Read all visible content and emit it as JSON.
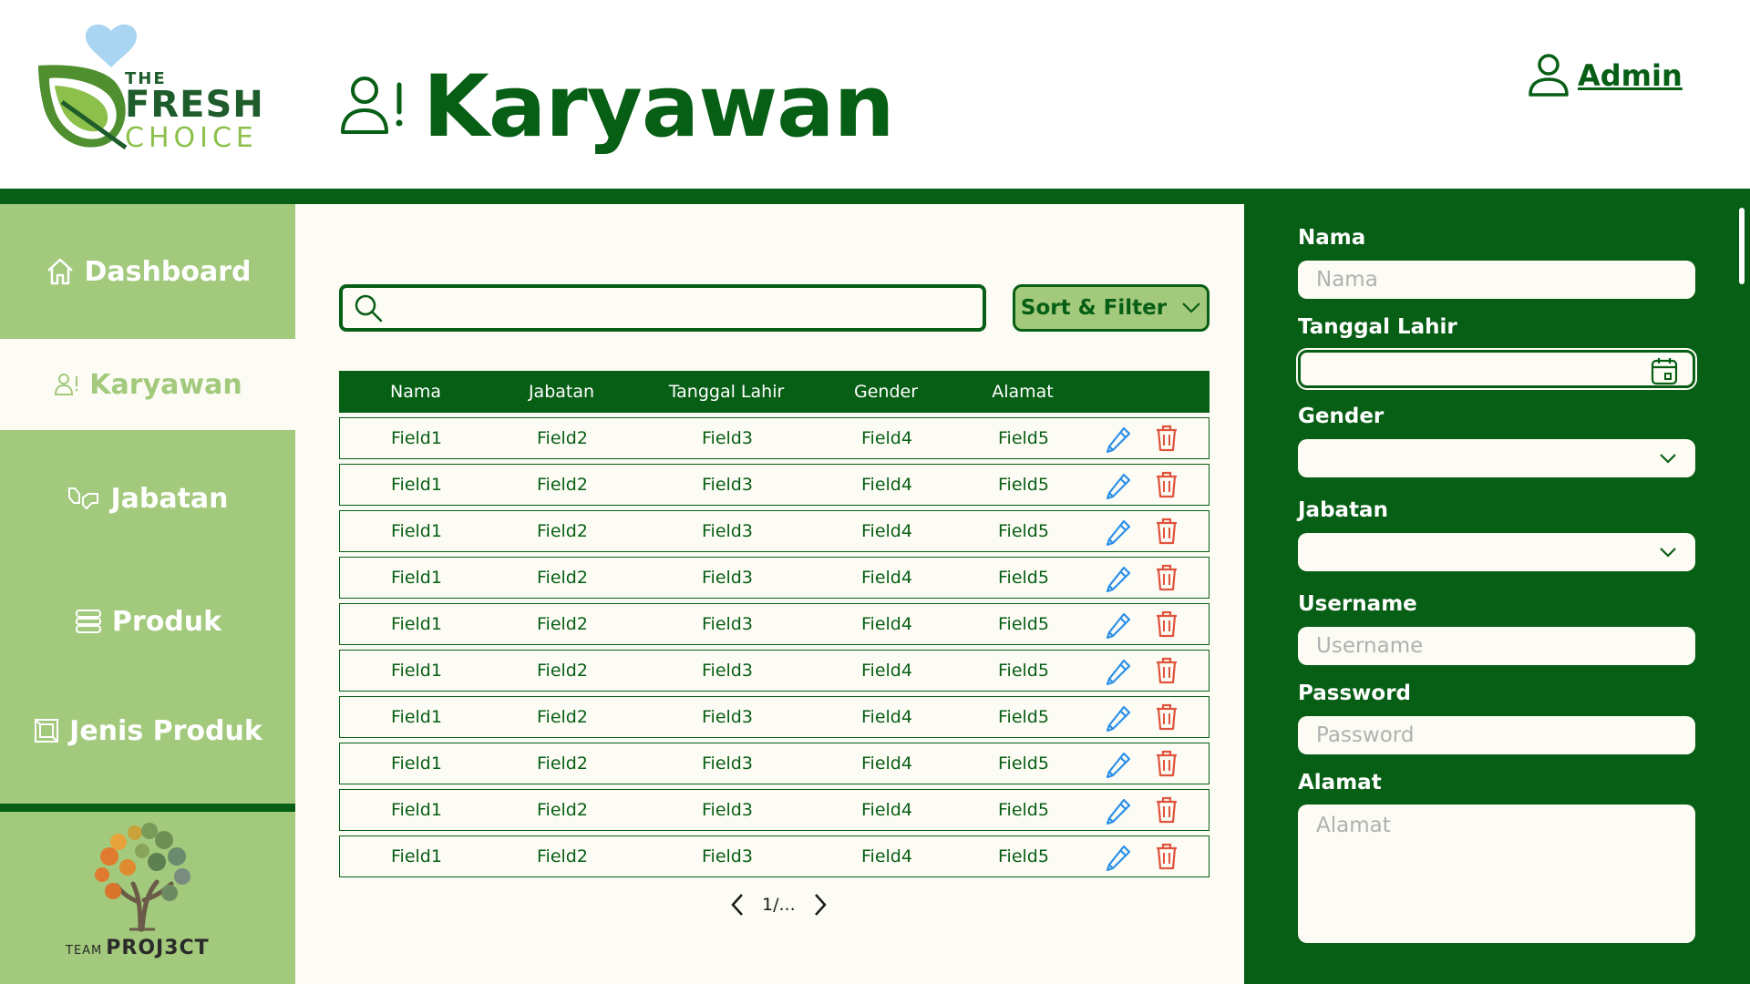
{
  "brand": {
    "logo_the": "THE",
    "logo_fresh": "FRESH",
    "logo_choice": "CHOICE",
    "team_small": "TEAM",
    "team_big": "PROJ3CT"
  },
  "header": {
    "title": "Karyawan",
    "user_label": "Admin"
  },
  "sidebar": {
    "items": [
      {
        "label": "Dashboard",
        "icon": "home-icon",
        "active": false
      },
      {
        "label": "Karyawan",
        "icon": "employee-icon",
        "active": true
      },
      {
        "label": "Jabatan",
        "icon": "handshake-icon",
        "active": false
      },
      {
        "label": "Produk",
        "icon": "stack-icon",
        "active": false
      },
      {
        "label": "Jenis Produk",
        "icon": "frame-icon",
        "active": false
      }
    ]
  },
  "toolbar": {
    "search_placeholder": "",
    "sort_filter_label": "Sort & Filter"
  },
  "table": {
    "columns": [
      "Nama",
      "Jabatan",
      "Tanggal Lahir",
      "Gender",
      "Alamat"
    ],
    "rows": [
      [
        "Field1",
        "Field2",
        "Field3",
        "Field4",
        "Field5"
      ],
      [
        "Field1",
        "Field2",
        "Field3",
        "Field4",
        "Field5"
      ],
      [
        "Field1",
        "Field2",
        "Field3",
        "Field4",
        "Field5"
      ],
      [
        "Field1",
        "Field2",
        "Field3",
        "Field4",
        "Field5"
      ],
      [
        "Field1",
        "Field2",
        "Field3",
        "Field4",
        "Field5"
      ],
      [
        "Field1",
        "Field2",
        "Field3",
        "Field4",
        "Field5"
      ],
      [
        "Field1",
        "Field2",
        "Field3",
        "Field4",
        "Field5"
      ],
      [
        "Field1",
        "Field2",
        "Field3",
        "Field4",
        "Field5"
      ],
      [
        "Field1",
        "Field2",
        "Field3",
        "Field4",
        "Field5"
      ],
      [
        "Field1",
        "Field2",
        "Field3",
        "Field4",
        "Field5"
      ]
    ],
    "row_actions": [
      "pencil-icon",
      "trash-icon"
    ]
  },
  "pagination": {
    "label": "1/..."
  },
  "form": {
    "nama_label": "Nama",
    "nama_placeholder": "Nama",
    "tanggal_label": "Tanggal Lahir",
    "tanggal_value": "",
    "gender_label": "Gender",
    "gender_value": "",
    "jabatan_label": "Jabatan",
    "jabatan_value": "",
    "username_label": "Username",
    "username_placeholder": "Username",
    "password_label": "Password",
    "password_placeholder": "Password",
    "alamat_label": "Alamat",
    "alamat_placeholder": "Alamat"
  },
  "colors": {
    "primary_green": "#075e15",
    "light_green": "#a2c97c",
    "cream": "#fdfcf4",
    "delete_red": "#e0533d",
    "edit_blue": "#2b8fe8"
  }
}
